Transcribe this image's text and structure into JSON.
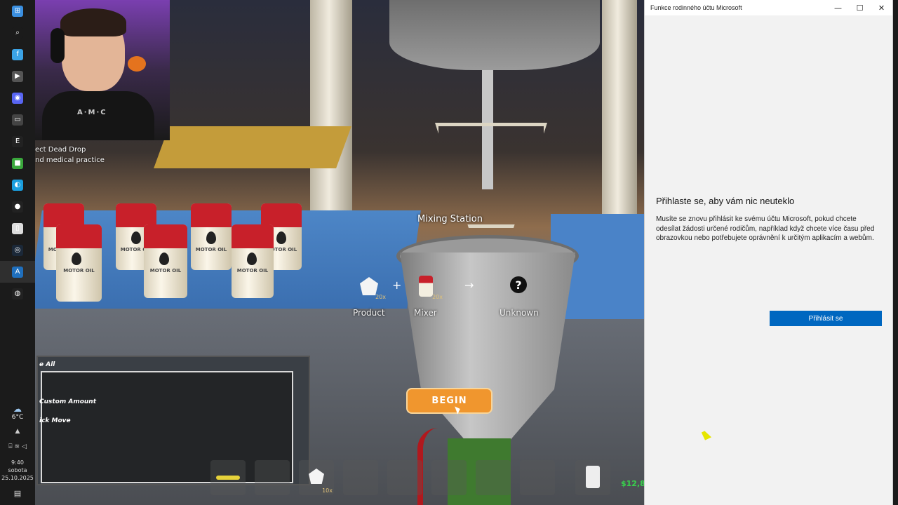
{
  "taskbar": {
    "icons": [
      {
        "name": "windows-start-icon",
        "glyph": "⊞",
        "color": "#3a8fe0"
      },
      {
        "name": "search-icon",
        "glyph": "⌕",
        "color": "#1b1b1b"
      },
      {
        "name": "app-f-icon",
        "glyph": "f",
        "color": "#3ba3e6"
      },
      {
        "name": "media-player-icon",
        "glyph": "▶",
        "color": "#555"
      },
      {
        "name": "discord-icon",
        "glyph": "◉",
        "color": "#5865f2"
      },
      {
        "name": "app-window-icon",
        "glyph": "▭",
        "color": "#444"
      },
      {
        "name": "epic-games-icon",
        "glyph": "E",
        "color": "#222"
      },
      {
        "name": "minecraft-icon",
        "glyph": "■",
        "color": "#3aa73c"
      },
      {
        "name": "edge-browser-icon",
        "glyph": "◐",
        "color": "#1a9ede"
      },
      {
        "name": "obs-icon",
        "glyph": "●",
        "color": "#222"
      },
      {
        "name": "file-icon",
        "glyph": "▯",
        "color": "#ddd"
      },
      {
        "name": "steam-icon",
        "glyph": "◎",
        "color": "#1b2838"
      },
      {
        "name": "app-blue-icon",
        "glyph": "A",
        "color": "#1f6fbd"
      },
      {
        "name": "record-icon",
        "glyph": "◍",
        "color": "#222"
      }
    ],
    "weather_temp": "6°C",
    "clock_time": "9:40",
    "clock_day": "sobota",
    "clock_date": "25.10.2025"
  },
  "game": {
    "quest_line1": "ect Dead Drop",
    "quest_line2": "nd medical practice",
    "streamer_shirt": "A·M·C",
    "can_label": "MOTOR OIL",
    "station_label": "Mixing Station",
    "recipe": {
      "product_label": "Product",
      "product_qty": "20x",
      "plus": "+",
      "mixer_label": "Mixer",
      "mixer_qty": "20x",
      "arrow": "→",
      "unknown_label": "Unknown",
      "unknown_symbol": "?"
    },
    "begin_button": "BEGIN",
    "panel_lines": [
      "e All",
      "Custom Amount",
      "ick Move"
    ],
    "hotbar_qty": "10x",
    "money": "$12,8"
  },
  "window": {
    "title": "Funkce rodinného účtu Microsoft",
    "minimize": "—",
    "maximize": "☐",
    "close": "✕",
    "heading": "Přihlaste se, aby vám nic neuteklo",
    "body": "Musíte se znovu přihlásit ke svému účtu Microsoft, pokud chcete odesílat žádosti určené rodičům, například když chcete více času před obrazovkou nebo potřebujete oprávnění k určitým aplikacím a webům.",
    "button": "Přihlásit se"
  }
}
